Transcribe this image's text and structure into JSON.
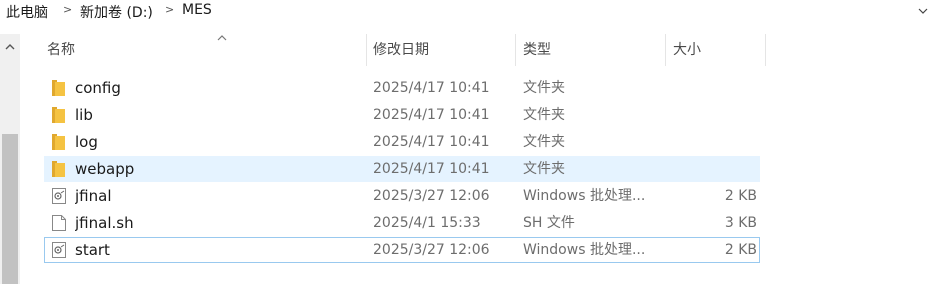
{
  "breadcrumb": {
    "items": [
      "此电脑",
      "新加卷 (D:)",
      "MES"
    ]
  },
  "columns": {
    "name": "名称",
    "modified": "修改日期",
    "type": "类型",
    "size": "大小"
  },
  "files": [
    {
      "name": "config",
      "modified": "2025/4/17 10:41",
      "type": "文件夹",
      "size": "",
      "icon": "folder-icon"
    },
    {
      "name": "lib",
      "modified": "2025/4/17 10:41",
      "type": "文件夹",
      "size": "",
      "icon": "folder-icon"
    },
    {
      "name": "log",
      "modified": "2025/4/17 10:41",
      "type": "文件夹",
      "size": "",
      "icon": "folder-icon"
    },
    {
      "name": "webapp",
      "modified": "2025/4/17 10:41",
      "type": "文件夹",
      "size": "",
      "icon": "folder-icon"
    },
    {
      "name": "jfinal",
      "modified": "2025/3/27 12:06",
      "type": "Windows 批处理...",
      "size": "2 KB",
      "icon": "batch-file-icon"
    },
    {
      "name": "jfinal.sh",
      "modified": "2025/4/1 15:33",
      "type": "SH 文件",
      "size": "3 KB",
      "icon": "text-file-icon"
    },
    {
      "name": "start",
      "modified": "2025/3/27 12:06",
      "type": "Windows 批处理...",
      "size": "2 KB",
      "icon": "batch-file-icon"
    }
  ],
  "colors": {
    "folder": "#f5c342",
    "hover_row": "#e5f3ff",
    "focus_border": "#99c9ef"
  }
}
